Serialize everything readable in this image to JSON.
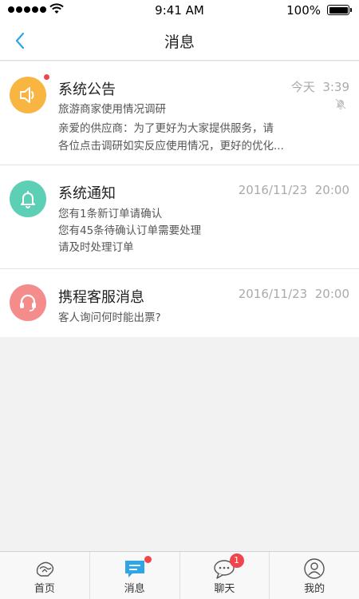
{
  "status_bar": {
    "time": "9:41 AM",
    "battery": "100%"
  },
  "header": {
    "title": "消息",
    "back_icon": "chevron-left-icon"
  },
  "colors": {
    "accent": "#2fa5e6",
    "announcement_avatar": "#f9b542",
    "notice_avatar": "#5ccfb5",
    "service_avatar": "#f58c8c",
    "badge": "#f0464b"
  },
  "messages": [
    {
      "icon": "speaker-icon",
      "title": "系统公告",
      "date": "今天",
      "time": "3:39",
      "subtitle": "旅游商家使用情况调研",
      "lines": [
        "亲爱的供应商：为了更好为大家提供服务，请",
        "各位点击调研如实反应使用情况，更好的优化..."
      ],
      "unread": true,
      "muted_icon": "bell-off-icon"
    },
    {
      "icon": "bell-icon",
      "title": "系统通知",
      "date": "2016/11/23",
      "time": "20:00",
      "lines": [
        "您有1条新订单请确认",
        "您有45条待确认订单需要处理",
        "请及时处理订单"
      ]
    },
    {
      "icon": "headset-icon",
      "title": "携程客服消息",
      "date": "2016/11/23",
      "time": "20:00",
      "lines": [
        "客人询问何时能出票?"
      ]
    }
  ],
  "tabbar": {
    "tabs": [
      {
        "label": "首页",
        "icon": "home-icon"
      },
      {
        "label": "消息",
        "icon": "message-icon",
        "dot": true
      },
      {
        "label": "聊天",
        "icon": "chat-icon",
        "badge": "1"
      },
      {
        "label": "我的",
        "icon": "profile-icon"
      }
    ]
  }
}
